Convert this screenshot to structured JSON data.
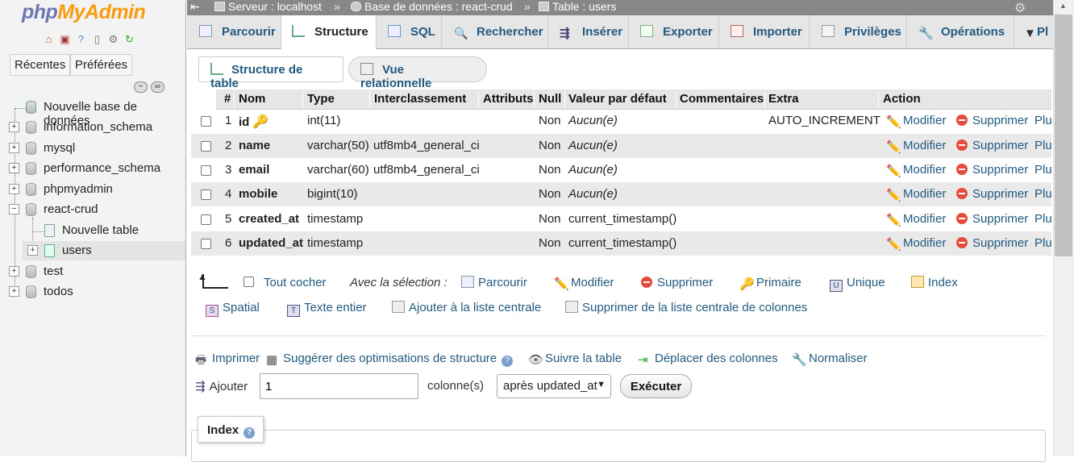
{
  "logo": {
    "part1": "php",
    "part2": "MyAdmin"
  },
  "nav": {
    "recent": "Récentes",
    "favorites": "Préférées",
    "new_db": "Nouvelle base de données",
    "databases": [
      "information_schema",
      "mysql",
      "performance_schema",
      "phpmyadmin",
      "react-crud"
    ],
    "new_table": "Nouvelle table",
    "table_users": "users",
    "databases_after": [
      "test",
      "todos"
    ]
  },
  "breadcrumb": {
    "server": "Serveur : localhost",
    "database": "Base de données : react-crud",
    "table": "Table : users",
    "sep": "»"
  },
  "tabs": [
    "Parcourir",
    "Structure",
    "SQL",
    "Rechercher",
    "Insérer",
    "Exporter",
    "Importer",
    "Privilèges",
    "Opérations",
    "Pl"
  ],
  "subtabs": {
    "structure": "Structure de table",
    "relational": "Vue relationnelle"
  },
  "columns_header": [
    "#",
    "Nom",
    "Type",
    "Interclassement",
    "Attributs",
    "Null",
    "Valeur par défaut",
    "Commentaires",
    "Extra",
    "Action"
  ],
  "rows": [
    {
      "num": "1",
      "name": "id",
      "type": "int(11)",
      "collation": "",
      "null": "Non",
      "default": "Aucun(e)",
      "default_italic": true,
      "extra": "AUTO_INCREMENT"
    },
    {
      "num": "2",
      "name": "name",
      "type": "varchar(50)",
      "collation": "utf8mb4_general_ci",
      "null": "Non",
      "default": "Aucun(e)",
      "extra": ""
    },
    {
      "num": "3",
      "name": "email",
      "type": "varchar(60)",
      "collation": "utf8mb4_general_ci",
      "null": "Non",
      "default": "Aucun(e)",
      "extra": ""
    },
    {
      "num": "4",
      "name": "mobile",
      "type": "bigint(10)",
      "collation": "",
      "null": "Non",
      "default": "Aucun(e)",
      "extra": ""
    },
    {
      "num": "5",
      "name": "created_at",
      "type": "timestamp",
      "collation": "",
      "null": "Non",
      "default": "current_timestamp()",
      "extra": ""
    },
    {
      "num": "6",
      "name": "updated_at",
      "type": "timestamp",
      "collation": "",
      "null": "Non",
      "default": "current_timestamp()",
      "extra": ""
    }
  ],
  "row_actions": {
    "modify": "Modifier",
    "delete": "Supprimer",
    "more": "Plu"
  },
  "selection": {
    "check_all": "Tout cocher",
    "with_selected": "Avec la sélection :",
    "browse": "Parcourir",
    "modify": "Modifier",
    "delete": "Supprimer",
    "primary": "Primaire",
    "unique": "Unique",
    "index": "Index",
    "spatial": "Spatial",
    "fulltext": "Texte entier",
    "add_central": "Ajouter à la liste centrale",
    "remove_central": "Supprimer de la liste centrale de colonnes"
  },
  "tools": {
    "print": "Imprimer",
    "optimize": "Suggérer des optimisations de structure",
    "track": "Suivre la table",
    "move": "Déplacer des colonnes",
    "normalize": "Normaliser"
  },
  "add_columns": {
    "label": "Ajouter",
    "value": "1",
    "unit": "colonne(s)",
    "position": "après updated_at",
    "execute": "Exécuter"
  },
  "index_section": {
    "title": "Index"
  },
  "colors": {
    "link": "#235a81",
    "topbar": "#888888",
    "tabbar": "#e6e6e6",
    "stripe": "#e9e9e9",
    "delete_red": "#e34c3c"
  }
}
